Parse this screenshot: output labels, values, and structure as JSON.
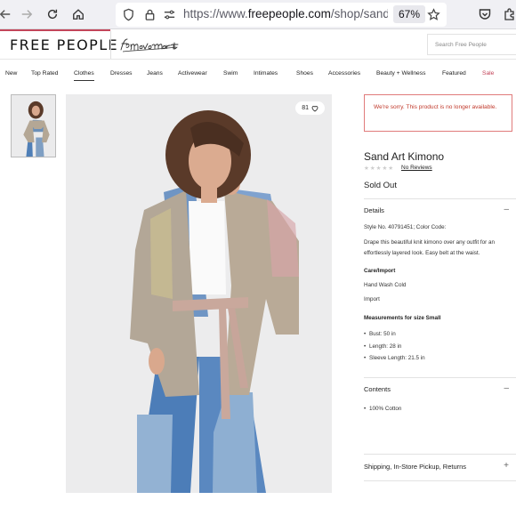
{
  "browser": {
    "url_prefix": "https://www.",
    "url_host": "freepeople.com",
    "url_path": "/shop/sand-art",
    "zoom": "67%"
  },
  "header": {
    "logo": "FREE PEOPLE",
    "sub_brand_logo": "fpmovement",
    "search_placeholder": "Search Free People"
  },
  "nav": {
    "items": [
      {
        "label": "New"
      },
      {
        "label": "Top Rated"
      },
      {
        "label": "Clothes"
      },
      {
        "label": "Dresses"
      },
      {
        "label": "Jeans"
      },
      {
        "label": "Activewear"
      },
      {
        "label": "Swim"
      },
      {
        "label": "Intimates"
      },
      {
        "label": "Shoes"
      },
      {
        "label": "Accessories"
      },
      {
        "label": "Beauty + Wellness"
      },
      {
        "label": "Featured"
      },
      {
        "label": "Sale"
      }
    ],
    "active_index": 2
  },
  "gallery": {
    "like_count": "81"
  },
  "product": {
    "alert": "We're sorry. This product is no longer available.",
    "name": "Sand Art Kimono",
    "rating_stars": "★★★★★",
    "reviews_link": "No Reviews",
    "status": "Sold Out",
    "details": {
      "heading": "Details",
      "style_line": "Style No. 40791451; Color Code:",
      "description": "Drape this beautiful knit kimono over any outfit for an effortlessly layered look. Easy belt at the waist.",
      "care_heading": "Care/Import",
      "care": "Hand Wash Cold",
      "origin": "Import",
      "measure_heading": "Measurements for size Small",
      "measurements": [
        "Bust: 50 in",
        "Length: 28 in",
        "Sleeve Length: 21.5 in"
      ]
    },
    "contents": {
      "heading": "Contents",
      "items": [
        "100% Cotton"
      ]
    },
    "shipping": {
      "heading": "Shipping, In-Store Pickup, Returns"
    }
  }
}
